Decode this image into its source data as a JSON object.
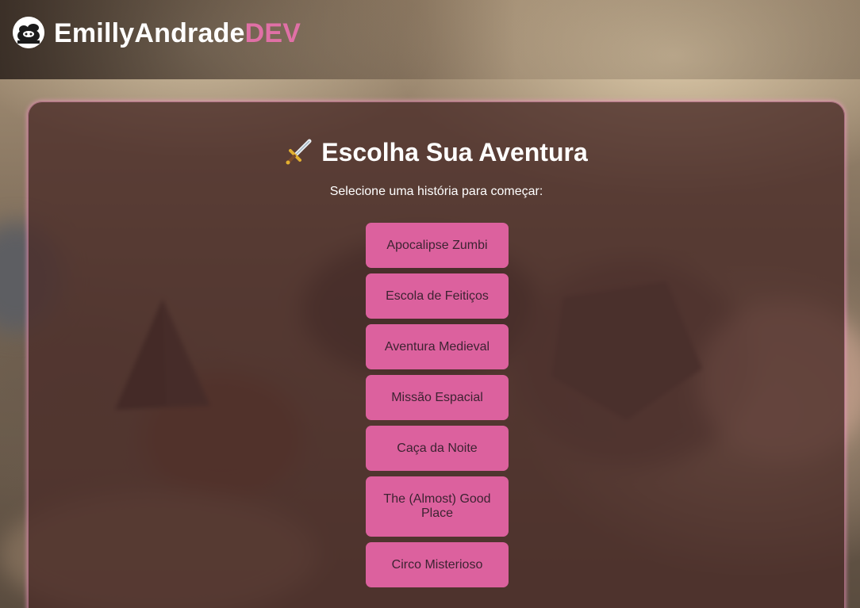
{
  "header": {
    "brand_primary": "EmillyAndrade",
    "brand_accent": "DEV",
    "logo_icon": "panda-avatar-icon"
  },
  "main": {
    "title_icon": "dagger-icon",
    "title": "Escolha Sua Aventura",
    "subtitle": "Selecione uma história para começar:",
    "stories": [
      "Apocalipse Zumbi",
      "Escola de Feitiços",
      "Aventura Medieval",
      "Missão Espacial",
      "Caça da Noite",
      "The (Almost) Good Place",
      "Circo Misterioso"
    ]
  },
  "colors": {
    "accent": "#e070a6",
    "button": "#dc619e",
    "panel": "#4a2c28"
  }
}
